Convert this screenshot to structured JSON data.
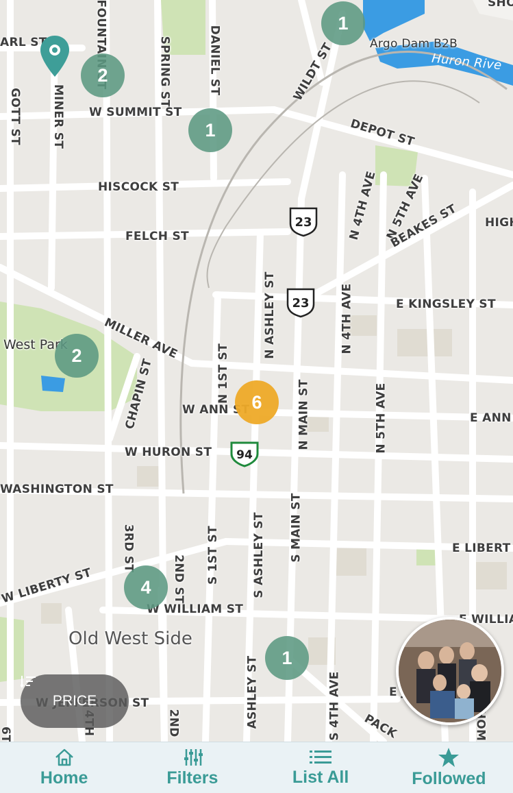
{
  "map": {
    "streets": {
      "earl": "ARL ST",
      "fountain": "FOUNTAIN ST",
      "spring": "SPRING ST",
      "daniel": "DANIEL ST",
      "wildt": "WILDT ST",
      "gott": "GOTT ST",
      "miner": "MINER ST",
      "summit": "W SUMMIT ST",
      "depot": "DEPOT ST",
      "hiscock": "HISCOCK ST",
      "felch": "FELCH ST",
      "n4th_upper": "N 4TH AVE",
      "n5th_upper": "N 5TH AVE",
      "beakes": "BEAKES ST",
      "high": "HIGH",
      "n_ashley": "N ASHLEY ST",
      "n4th_lower": "N 4TH AVE",
      "kingsley": "E KINGSLEY ST",
      "miller": "MILLER AVE",
      "n1st": "N 1ST ST",
      "chapin": "CHAPIN ST",
      "w_ann": "W ANN ST",
      "n_main": "N MAIN ST",
      "n5th_lower": "N 5TH AVE",
      "e_ann": "E ANN",
      "w_huron": "W HURON ST",
      "washington": "WASHINGTON ST",
      "third": "3RD ST",
      "s1st": "S 1ST ST",
      "s_ashley": "S ASHLEY ST",
      "s_main": "S MAIN ST",
      "e_liberty": "E LIBERT",
      "w_liberty": "W LIBERTY ST",
      "second": "2ND ST",
      "w_william": "W WILLIAM ST",
      "e_william": "E WILLIAM",
      "jefferson": "W JEFFERSON ST",
      "s4th": "S 4TH AVE",
      "ashley_bottom": "ASHLEY ST",
      "pack": "PACK",
      "s_ej": "E J",
      "second_bottom": "2ND",
      "fourth_bottom": "4TH",
      "s_sixth": "6T",
      "hom": "HOM",
      "top_right": "SHO"
    },
    "places": {
      "river": "Huron Rive",
      "dam": "Argo Dam B2B",
      "park": "West Park",
      "area": "Old West Side"
    },
    "routes": {
      "us23_a": "23",
      "us23_b": "23",
      "i94": "94"
    },
    "clusters": [
      {
        "count": "1"
      },
      {
        "count": "2"
      },
      {
        "count": "1"
      },
      {
        "count": "2"
      },
      {
        "count": "6"
      },
      {
        "count": "4"
      },
      {
        "count": "1"
      }
    ]
  },
  "price_button": {
    "label": "PRICE"
  },
  "nav": [
    {
      "label": "Home",
      "icon": "home-icon"
    },
    {
      "label": "Filters",
      "icon": "sliders-icon"
    },
    {
      "label": "List All",
      "icon": "list-icon"
    },
    {
      "label": "Followed",
      "icon": "star-icon"
    }
  ],
  "colors": {
    "cluster": "#5c9882",
    "cluster_hot": "#eeaa28",
    "water": "#3b9ce3",
    "park": "#cfe3b5",
    "nav_text": "#3a9b96"
  }
}
